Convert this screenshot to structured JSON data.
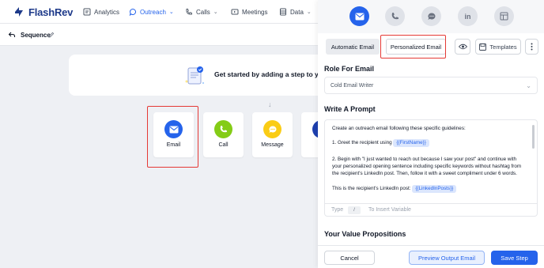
{
  "app": {
    "name": "FlashRev"
  },
  "nav": {
    "items": [
      {
        "label": "Analytics"
      },
      {
        "label": "Outreach",
        "caret": "⌄"
      },
      {
        "label": "Calls",
        "caret": "⌄"
      },
      {
        "label": "Meetings"
      },
      {
        "label": "Data",
        "caret": "⌄"
      }
    ]
  },
  "sequence": {
    "title": "Sequence"
  },
  "canvas": {
    "get_started": "Get started by adding a step to your",
    "steps": [
      {
        "label": "Email",
        "color": "#2563eb",
        "icon": "envelope-icon"
      },
      {
        "label": "Call",
        "color": "#84cc16",
        "icon": "phone-icon"
      },
      {
        "label": "Message",
        "color": "#facc15",
        "icon": "chat-icon"
      },
      {
        "label": "Lin",
        "color": "#1e40af",
        "icon": "linkedin-icon"
      }
    ]
  },
  "panel": {
    "channels": [
      "email-icon",
      "phone-icon",
      "chat-icon",
      "linkedin-icon",
      "template-icon"
    ],
    "tabs": {
      "automatic": "Automatic Email",
      "personalized": "Personalized Email"
    },
    "templates_label": "Templates",
    "role_title": "Role For Email",
    "role_value": "Cold Email Writer",
    "prompt_title": "Write A Prompt",
    "prompt": {
      "l1": "Create an outreach email following these specific guidelines:",
      "l2": "1. Greet the recipient using",
      "var_first": "{{FirstName}}",
      "l3": "2. Begin with \"I just wanted to reach out because I saw your post\" and continue with",
      "l4": "your personalized opening sentence including specific keywords without hashtag from",
      "l5": "the recipient's LinkedIn post. Then, follow it with a sweet compliment under 6 words.",
      "l6": "This is the recipient's LinkedIn post:",
      "var_posts": "{{LinkedInPosts}}"
    },
    "type_hint": {
      "type": "Type",
      "key": "/",
      "rest": "To Insert Variable"
    },
    "value_prop_title": "Your Value Propositions",
    "buttons": {
      "cancel": "Cancel",
      "preview": "Preview Output Email",
      "save": "Save Step"
    }
  },
  "colors": {
    "accent": "#2563eb",
    "highlight_box": "#e53935"
  }
}
